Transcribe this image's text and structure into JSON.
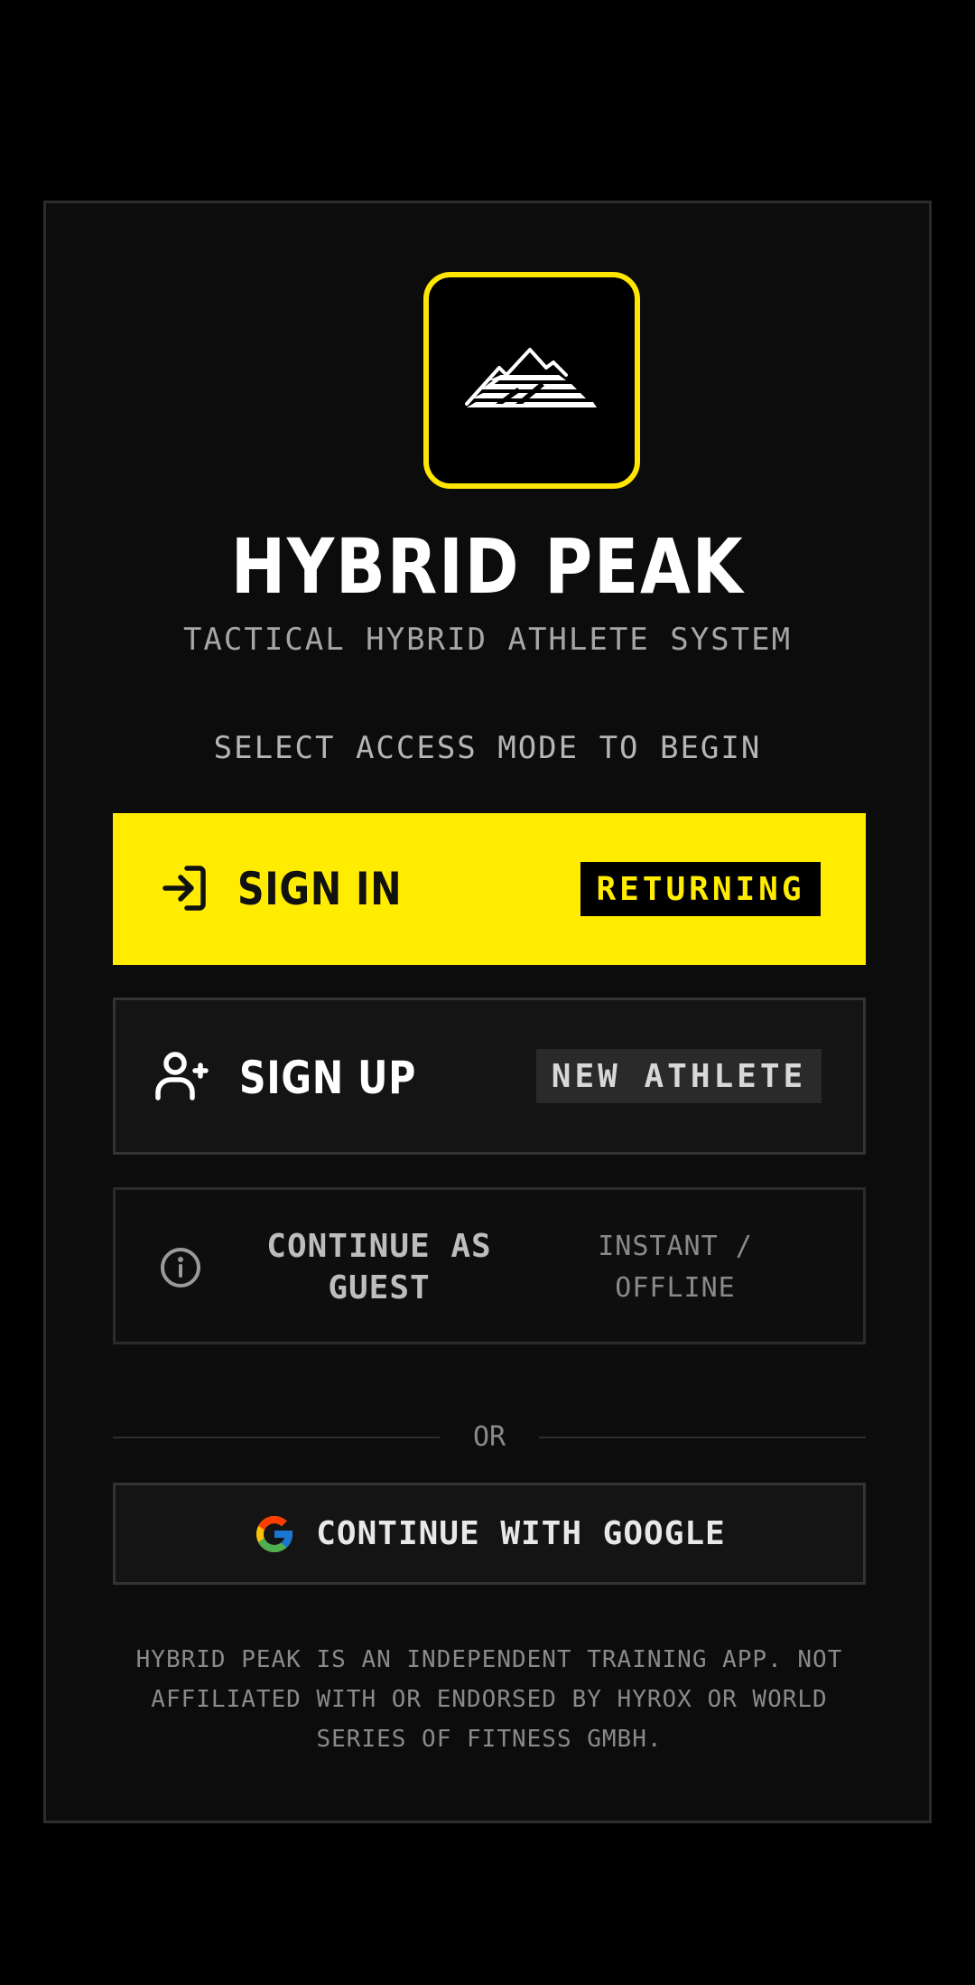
{
  "app": {
    "title": "HYBRID PEAK",
    "subtitle": "TACTICAL HYBRID ATHLETE SYSTEM",
    "prompt": "SELECT ACCESS MODE TO BEGIN"
  },
  "buttons": {
    "sign_in": {
      "label": "SIGN IN",
      "tag": "RETURNING",
      "icon": "sign-in-icon"
    },
    "sign_up": {
      "label": "SIGN UP",
      "tag": "NEW ATHLETE",
      "icon": "user-plus-icon"
    },
    "guest": {
      "label": "CONTINUE AS GUEST",
      "tag": "INSTANT / OFFLINE",
      "icon": "info-icon"
    },
    "google": {
      "label": "CONTINUE WITH GOOGLE",
      "icon": "google-icon"
    }
  },
  "divider": {
    "label": "OR"
  },
  "disclaimer": "HYBRID PEAK IS AN INDEPENDENT TRAINING APP. NOT AFFILIATED WITH OR ENDORSED BY HYROX OR WORLD SERIES OF FITNESS GMBH.",
  "colors": {
    "accent": "#ffec00",
    "background": "#000000",
    "card": "#0c0c0c"
  },
  "logo": {
    "icon": "mountain-logo-icon"
  }
}
